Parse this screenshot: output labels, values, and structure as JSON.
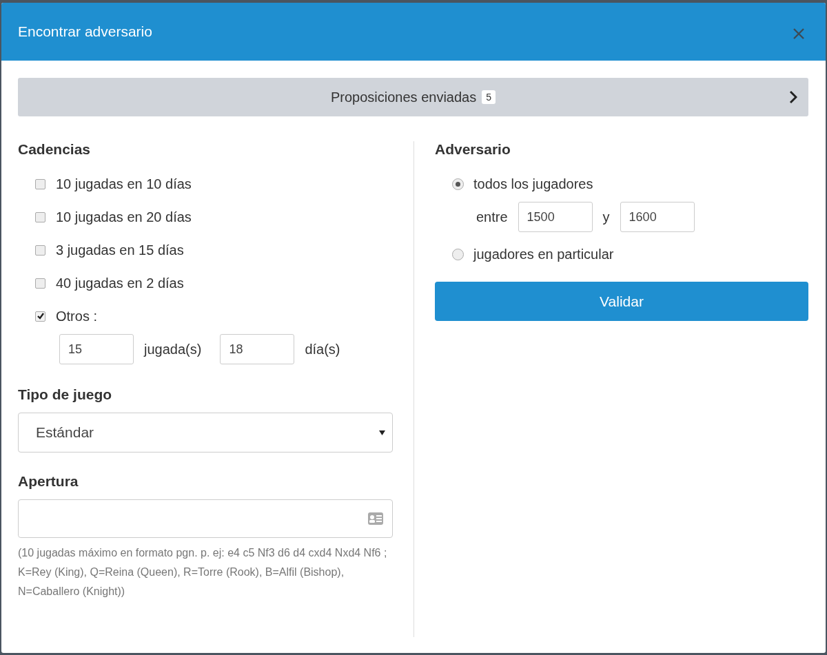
{
  "dialog": {
    "title": "Encontrar adversario"
  },
  "sent_bar": {
    "label": "Proposiciones enviadas",
    "count": "5"
  },
  "cadencias": {
    "heading": "Cadencias",
    "options": [
      {
        "label": "10 jugadas en 10 días",
        "checked": false
      },
      {
        "label": "10 jugadas en 20 días",
        "checked": false
      },
      {
        "label": "3 jugadas en 15 días",
        "checked": false
      },
      {
        "label": "40 jugadas en 2 días",
        "checked": false
      },
      {
        "label": "Otros :",
        "checked": true
      }
    ],
    "other": {
      "moves_value": "15",
      "moves_label": "jugada(s)",
      "days_value": "18",
      "days_label": "día(s)"
    }
  },
  "tipo": {
    "heading": "Tipo de juego",
    "value": "Estándar"
  },
  "apertura": {
    "heading": "Apertura",
    "help": "(10 jugadas máximo en formato pgn. p. ej: e4 c5 Nf3 d6 d4 cxd4 Nxd4 Nf6 ; K=Rey (King), Q=Reina (Queen), R=Torre (Rook), B=Alfil (Bishop), N=Caballero (Knight))"
  },
  "adversario": {
    "heading": "Adversario",
    "options": [
      {
        "label": "todos los jugadores",
        "selected": true
      },
      {
        "label": "jugadores en particular",
        "selected": false
      }
    ],
    "range": {
      "from_label": "entre",
      "from_value": "1500",
      "to_label": "y",
      "to_value": "1600"
    }
  },
  "submit": "Validar"
}
